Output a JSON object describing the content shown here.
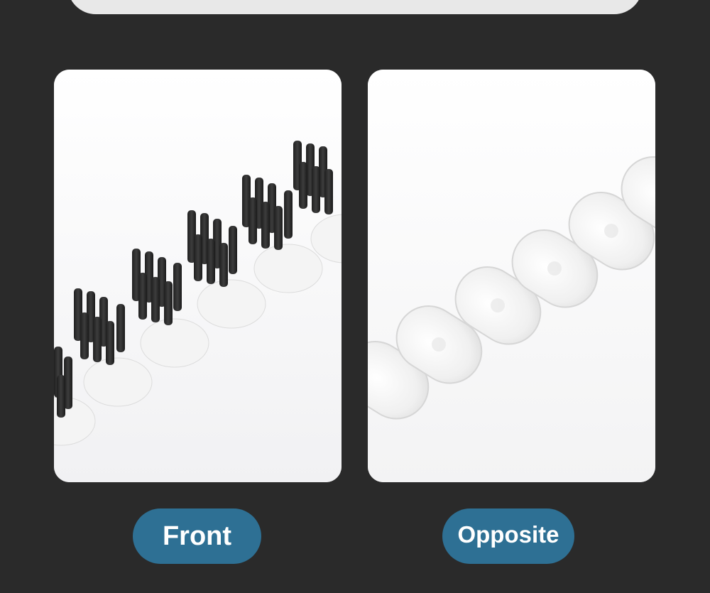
{
  "labels": {
    "front": "Front",
    "opposite": "Opposite"
  },
  "colors": {
    "background": "#2a2a2a",
    "pill": "#2e7094",
    "panel": "#ffffff"
  }
}
